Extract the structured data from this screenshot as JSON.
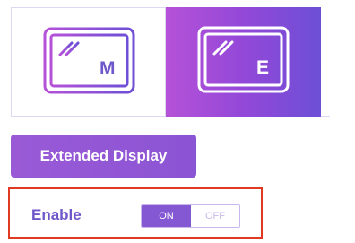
{
  "display_modes": [
    {
      "letter": "M",
      "selected": false
    },
    {
      "letter": "E",
      "selected": true
    }
  ],
  "extended_display_button": {
    "label": "Extended Display"
  },
  "enable": {
    "label": "Enable",
    "on_label": "ON",
    "off_label": "OFF",
    "value": "ON"
  },
  "colors": {
    "accent": "#8458d3",
    "selected_gradient_start": "#b552d8",
    "selected_gradient_end": "#6d4fd6",
    "highlight_border": "#e13a22"
  },
  "icons": [
    "monitor-icon",
    "monitor-icon"
  ]
}
